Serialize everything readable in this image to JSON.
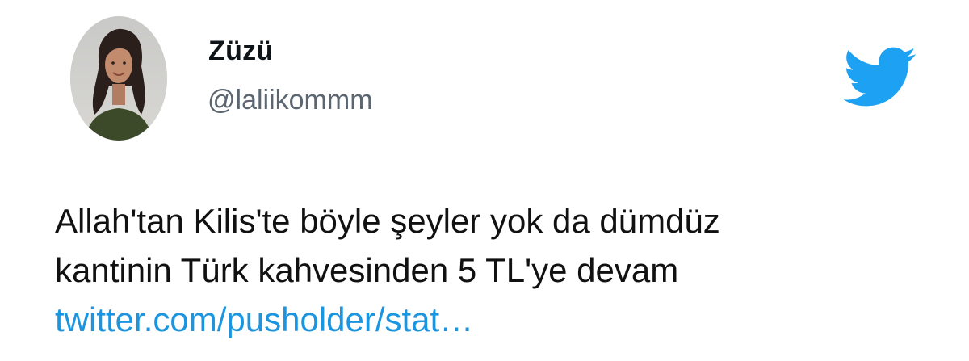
{
  "tweet": {
    "user": {
      "display_name": "Züzü",
      "handle": "@laliikommm",
      "avatar_icon": "profile-photo-icon"
    },
    "logo_icon": "twitter-bird-icon",
    "accent_color": "#1da1f2",
    "link_color": "#1b95e0",
    "text_lines": [
      "Allah'tan Kilis'te böyle şeyler yok da dümdüz",
      "kantinin Türk kahvesinden 5 TL'ye devam"
    ],
    "link_text": "twitter.com/pusholder/stat…"
  }
}
